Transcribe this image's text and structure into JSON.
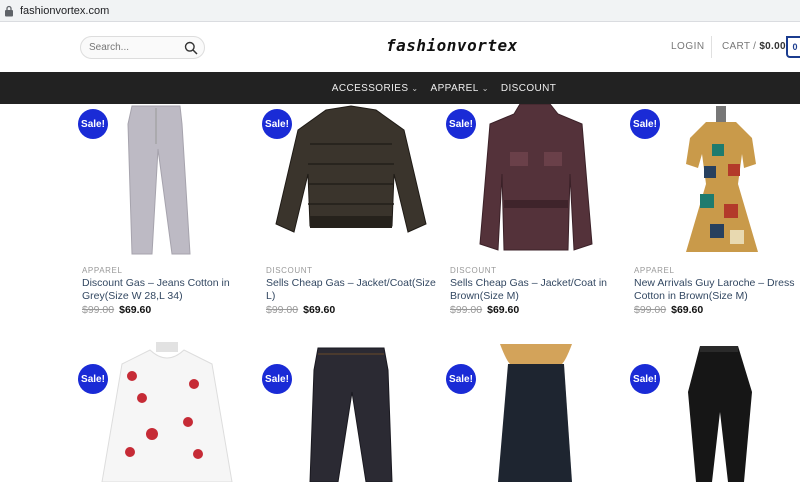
{
  "browser": {
    "url": "fashionvortex.com"
  },
  "header": {
    "search_placeholder": "Search...",
    "logo": "fashionvortex",
    "login": "LOGIN",
    "cart_label": "CART /",
    "cart_total": "$0.00",
    "cart_count": "0"
  },
  "nav": [
    {
      "label": "ACCESSORIES",
      "dropdown": true
    },
    {
      "label": "APPAREL",
      "dropdown": true
    },
    {
      "label": "DISCOUNT",
      "dropdown": false
    }
  ],
  "sale_badge": "Sale!",
  "products": [
    {
      "category": "APPAREL",
      "name_line1": "Discount Gas – Jeans Cotton in",
      "name_line2": "Grey(Size W 28,L 34)",
      "old_price": "$99.00",
      "new_price": "$69.60"
    },
    {
      "category": "DISCOUNT",
      "name_line1": "Sells Cheap Gas – Jacket/Coat(Size",
      "name_line2": "L)",
      "old_price": "$99.00",
      "new_price": "$69.60"
    },
    {
      "category": "DISCOUNT",
      "name_line1": "Sells Cheap Gas – Jacket/Coat in",
      "name_line2": "Brown(Size M)",
      "old_price": "$99.00",
      "new_price": "$69.60"
    },
    {
      "category": "APPAREL",
      "name_line1": "New Arrivals Guy Laroche – Dress",
      "name_line2": "Cotton in Brown(Size M)",
      "old_price": "$99.00",
      "new_price": "$69.60"
    }
  ],
  "colors": {
    "sale": "#1a2bd6",
    "nav_bg": "#222222",
    "link": "#334862"
  }
}
